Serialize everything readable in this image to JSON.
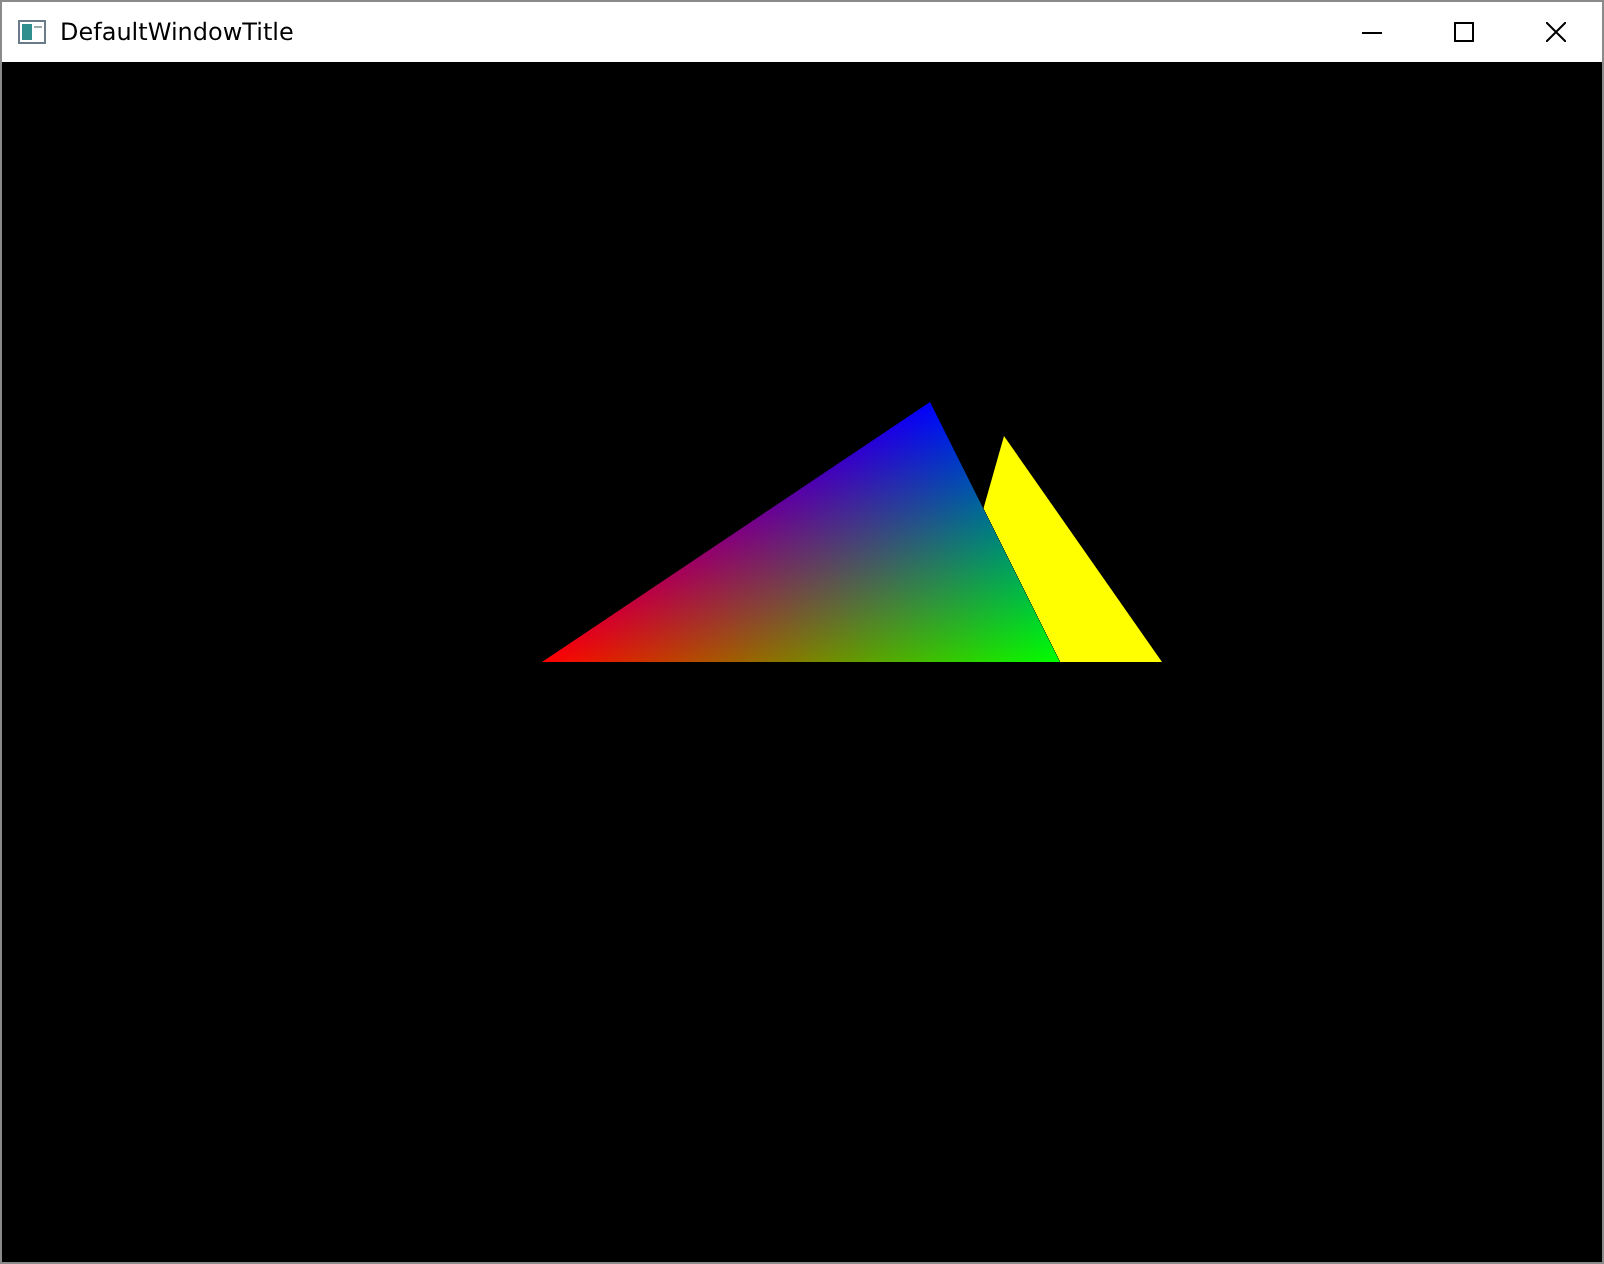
{
  "window": {
    "title": "DefaultWindowTitle"
  }
}
